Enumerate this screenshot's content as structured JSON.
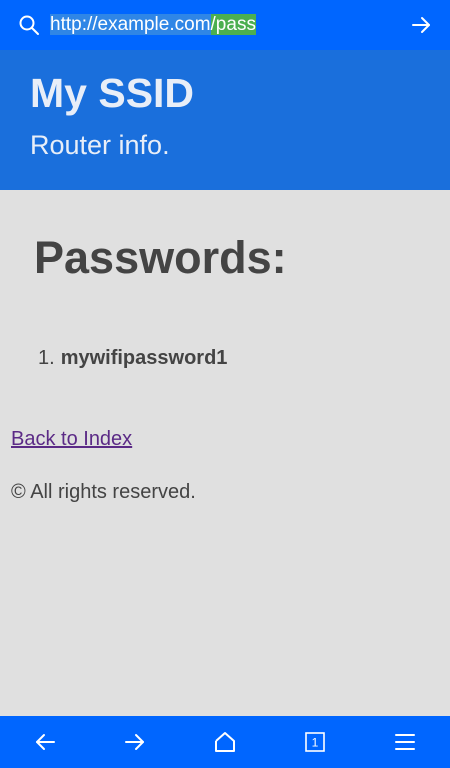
{
  "browser": {
    "url_base": "http://example.com",
    "url_path": "/pass",
    "tab_count": "1",
    "icons": {
      "search": "search-icon",
      "go": "arrow-right-icon",
      "back": "arrow-left-icon",
      "forward": "arrow-right-icon",
      "home": "home-icon",
      "tabs": "tabs-icon",
      "menu": "menu-icon"
    },
    "colors": {
      "bar": "#0066ff",
      "url_highlight": "#4caf50"
    }
  },
  "header": {
    "title": "My SSID",
    "subtitle": "Router info.",
    "background": "#1a6fdc"
  },
  "content": {
    "heading": "Passwords:",
    "passwords": [
      {
        "number": "1.",
        "value": "mywifipassword1"
      }
    ],
    "back_link": "Back to Index",
    "footer": "© All rights reserved."
  }
}
